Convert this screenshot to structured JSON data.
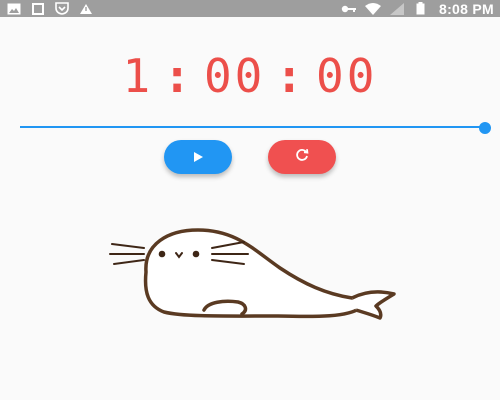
{
  "status_bar": {
    "time": "8:08 PM",
    "icons": [
      "image-icon",
      "square-icon",
      "shield-icon",
      "alert-triangle-icon",
      "key-icon",
      "wifi-icon",
      "signal-icon",
      "battery-icon"
    ]
  },
  "timer": {
    "hours": "1",
    "minutes": "00",
    "seconds": "00",
    "separator": ":"
  },
  "slider": {
    "value_fraction": 1.0
  },
  "controls": {
    "play_icon": "play-icon",
    "reset_icon": "refresh-icon"
  },
  "colors": {
    "accent_blue": "#2196f3",
    "accent_red": "#f05050",
    "timer_text": "#ec4f4a",
    "status_bar": "#9e9e9e"
  },
  "illustration": "seal-illustration"
}
